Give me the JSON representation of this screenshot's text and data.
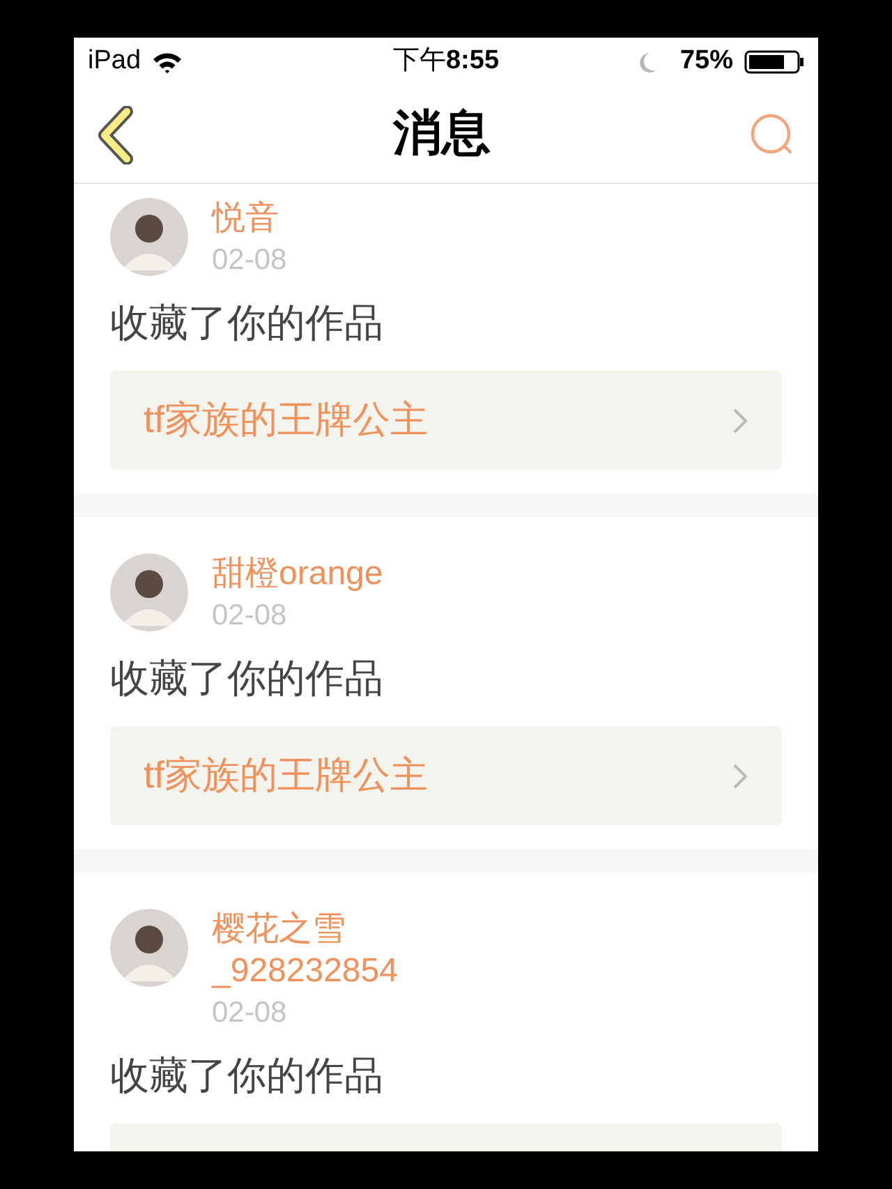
{
  "status_bar": {
    "device": "iPad",
    "time": "下午**8:55**",
    "battery": "75%"
  },
  "nav_bar": {
    "title": "消息"
  },
  "messages": [
    {
      "user": "悦音",
      "date": "02-08",
      "action": "收藏了你的作品",
      "work": "tf家族的王牌公主"
    },
    {
      "user": "甜橙orange",
      "date": "02-08",
      "action": "收藏了你的作品",
      "work": "tf家族的王牌公主"
    },
    {
      "user": "樱花之雪_928232854",
      "date": "02-08",
      "action": "收藏了你的作品"
    }
  ]
}
